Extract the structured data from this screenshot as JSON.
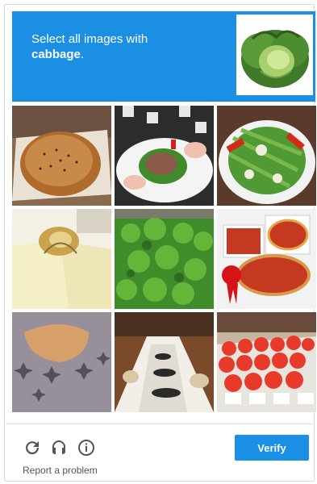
{
  "header": {
    "prompt_line1": "Select all images with",
    "prompt_target": "cabbage",
    "prompt_end": ".",
    "sample_image": "cabbage-sample"
  },
  "tiles": [
    {
      "label": "bread-loaf"
    },
    {
      "label": "meat-salad-plate"
    },
    {
      "label": "asparagus-salad"
    },
    {
      "label": "tofu-dish"
    },
    {
      "label": "green-leaves"
    },
    {
      "label": "deep-dish-pizza-photos"
    },
    {
      "label": "baked-cookie"
    },
    {
      "label": "banquet-tables"
    },
    {
      "label": "red-flowers-arrangement"
    }
  ],
  "footer": {
    "reload_icon": "reload-icon",
    "audio_icon": "headphones-icon",
    "info_icon": "info-icon",
    "report_label": "Report a problem",
    "verify_label": "Verify"
  },
  "colors": {
    "accent": "#1a8fe3"
  }
}
